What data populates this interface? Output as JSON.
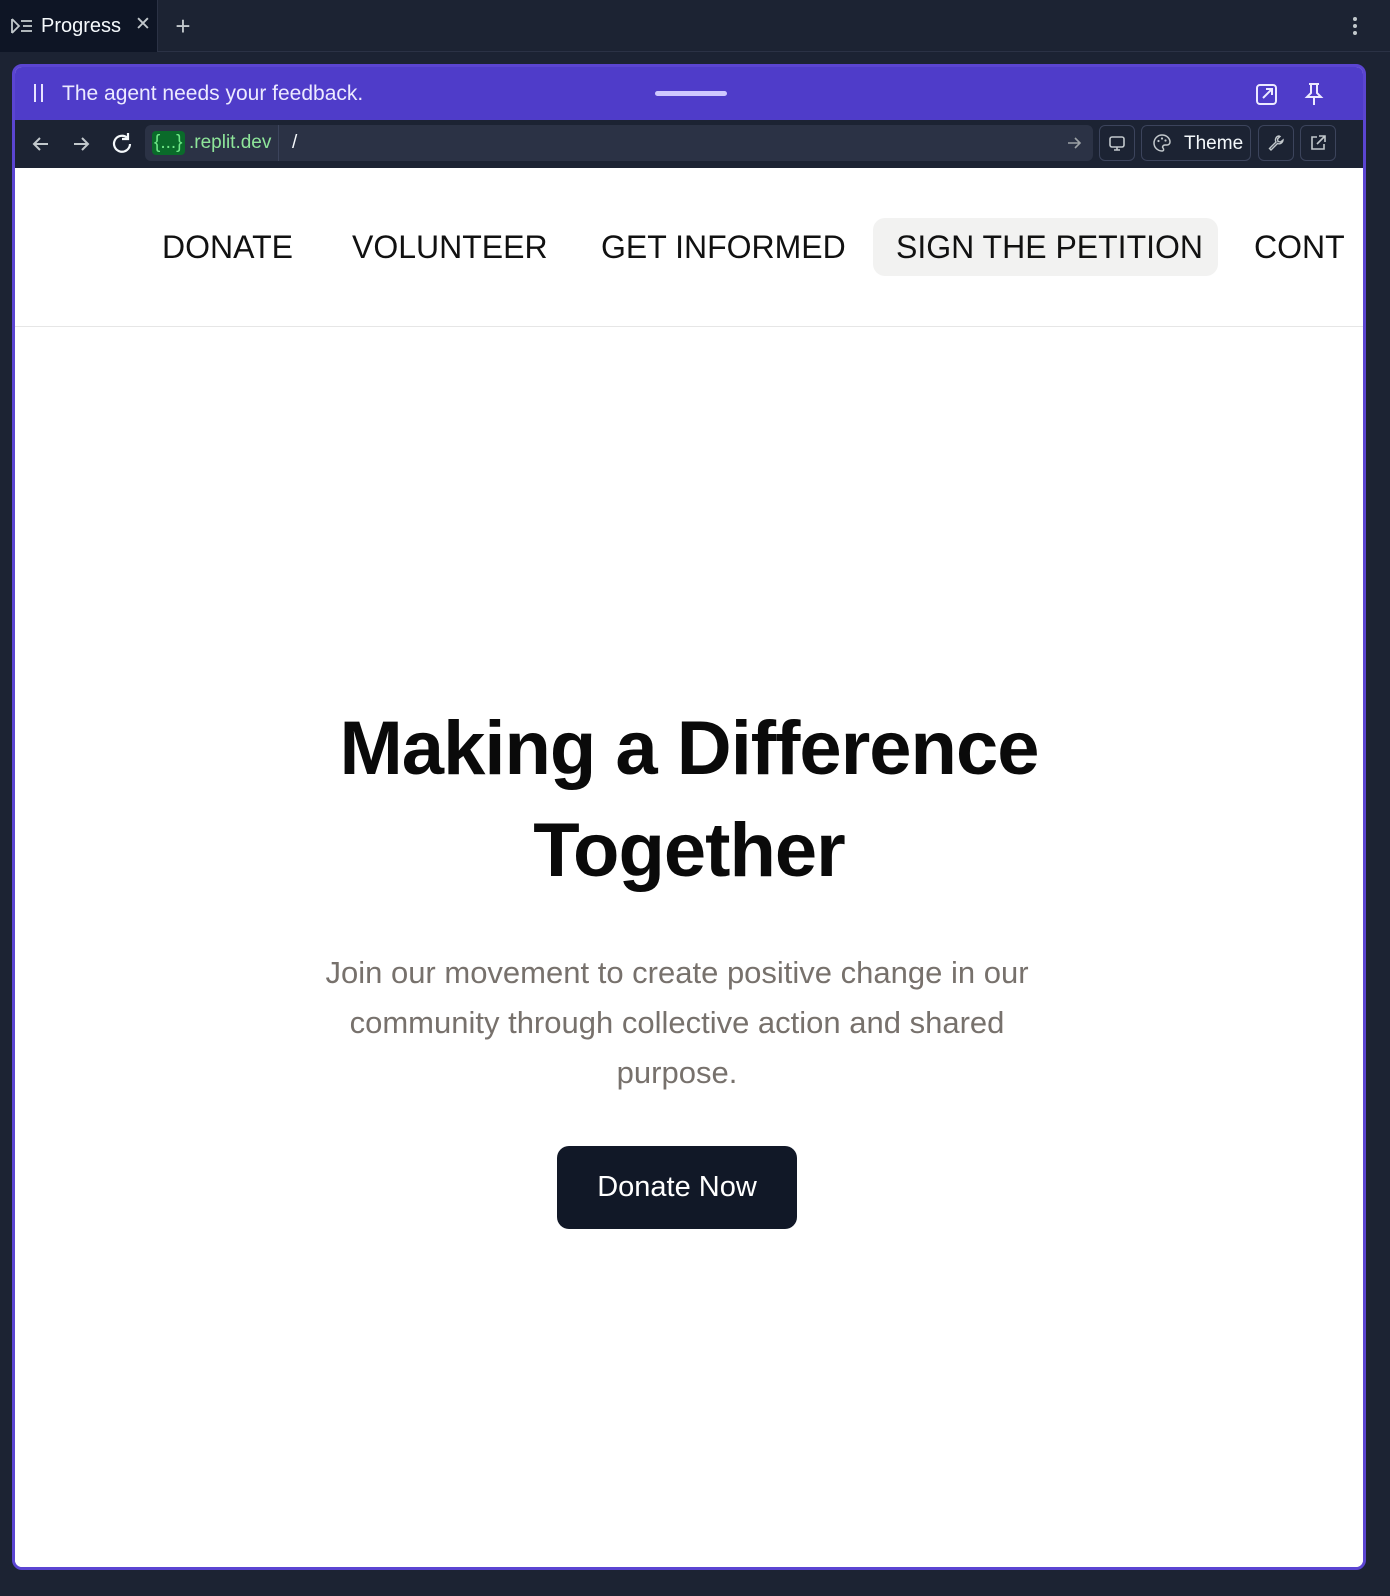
{
  "tabs": [
    {
      "title": "Progress",
      "icon": "progress-icon",
      "active": true
    }
  ],
  "agent_bar": {
    "message": "The agent needs your feedback.",
    "color": "#4f3cc9"
  },
  "browser": {
    "url_chip": "{...}",
    "url_host": ".replit.dev",
    "url_path": "/",
    "theme_label": "Theme"
  },
  "site": {
    "nav": [
      {
        "label": "DONATE"
      },
      {
        "label": "VOLUNTEER"
      },
      {
        "label": "GET INFORMED"
      },
      {
        "label": "SIGN THE PETITION",
        "active": true
      },
      {
        "label": "CONT"
      }
    ],
    "hero": {
      "title_line1": "Making a Difference",
      "title_line2": "Together",
      "subtitle": "Join our movement to create positive change in our community through collective action and shared purpose.",
      "cta_label": "Donate Now"
    }
  }
}
